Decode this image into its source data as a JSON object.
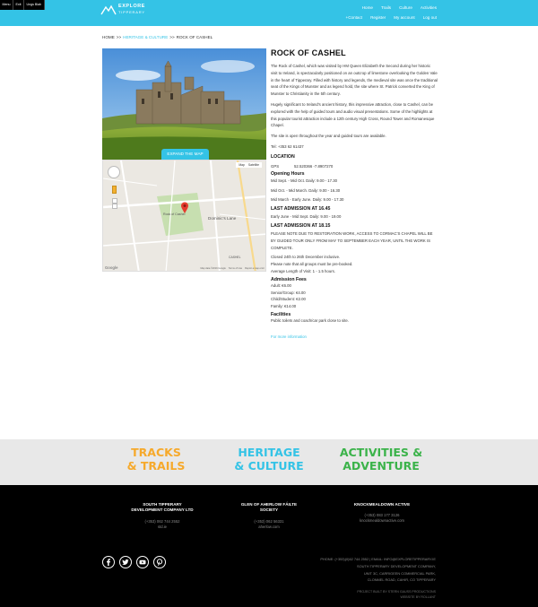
{
  "mini_menu": [
    "Menu",
    "Exit",
    "Ungs Blah"
  ],
  "brand": {
    "line1": "EXPLORE",
    "line2": "TIPPERARY"
  },
  "nav": {
    "primary": [
      "Home",
      "Trails",
      "Culture",
      "Activities"
    ],
    "secondary": [
      "+Contact",
      "Register",
      "My account",
      "Log out"
    ]
  },
  "breadcrumb": {
    "home": "HOME",
    "sep": ">>",
    "section": "HERITAGE & CULTURE",
    "current": "ROCK OF CASHEL"
  },
  "expand_map": "EXPAND THE MAP",
  "map": {
    "tabs": [
      "Map",
      "Satellite"
    ],
    "labels": [
      "Rock of Cashel",
      "Dominic's Lane",
      "CASHEL"
    ],
    "google": "Google",
    "footer": [
      "Map data ©2016 Google",
      "Terms of Use",
      "Report a map error"
    ]
  },
  "page": {
    "title": "ROCK OF CASHEL",
    "intro": "The Rock of Cashel, which was visited by HM Queen Elizabeth the Second during her historic visit to Ireland, is spectacularly positioned on an outcrop of limestone overlooking the Golden Vale in the heart of Tipperary. Filled with history and legends, the medieval site was once the traditional seat of the Kings of Munster and as legend hold, the site where St. Patrick converted the King of Munster to Christianity in the 5th century.",
    "intro2": "Hugely significant to Ireland's ancient history, this impressive attraction, close to Cashel, can be explored with the help of guided tours and audio visual presentations. Some of the highlights at this popular tourist attraction include a 12th century High Cross, Round Tower and Romanesque Chapel.",
    "open_note": "The site is open throughout the year and guided tours are available.",
    "tel": "Tel: +353 62 61437",
    "location_heading": "LOCATION",
    "gps_label": "GPS",
    "gps_value": "52.520366   -7.8907270",
    "hours_heading": "Opening Hours",
    "hours": [
      "Mid Sept. - Mid Oct. Daily: 9.00 - 17.30",
      "Mid Oct. - Mid March. Daily: 9.00 - 16.30",
      "Mid March - Early June. Daily: 9.00 - 17.30"
    ],
    "last_admission_1": "LAST ADMISSION AT 16.45",
    "summer_hours": "Early June - Mid Sept. Daily: 9.00 - 19.00",
    "last_admission_2": "LAST ADMISSION AT 18.15",
    "notice": "PLEASE NOTE DUE TO RESTORATION WORK, ACCESS TO CORMAC'S CHAPEL WILL BE BY GUIDED TOUR ONLY FROM MAY TO SEPTEMBER EACH YEAR, UNTIL THE WORK IS COMPLETE.",
    "closed": "Closed 24th to 26th December inclusive.",
    "groups": "Please note that all groups must be pre-booked.",
    "visit_length": "Average Length of Visit: 1 - 1.5 hours.",
    "fees_heading": "Admission Fees",
    "fees": [
      "Adult: €6.00",
      "Senior/Group: €4.00",
      "Child/Student: €2.00",
      "Family: €14.00"
    ],
    "facilities_heading": "Facilities",
    "facilities": "Public toilets and coach/car park close to site.",
    "more_link": "For more information"
  },
  "categories": [
    {
      "line1": "TRACKS",
      "line2": "& TRAILS",
      "color": "#f6a92b"
    },
    {
      "line1": "HERITAGE",
      "line2": "& CULTURE",
      "color": "#34c3e6"
    },
    {
      "line1": "ACTIVITIES &",
      "line2": "ADVENTURE",
      "color": "#3bb34a"
    }
  ],
  "orgs": [
    {
      "name1": "SOUTH TIPPERARY",
      "name2": "DEVELOPMENT COMPANY LTD",
      "phone": "(+353) 062 744 2552",
      "web": "std.ie"
    },
    {
      "name1": "GLEN OF AHERLOW FÁILTE",
      "name2": "SOCIETY",
      "phone": "(+353) 062 56331",
      "web": "aherlow.com"
    },
    {
      "name1": "KNOCKMEALDOWN ACTIVE",
      "name2": "",
      "phone": "(+353) 083 177 3126",
      "web": "knockmealdownactive.com"
    }
  ],
  "social_icons": [
    "facebook-icon",
    "twitter-icon",
    "youtube-icon",
    "pinterest-icon"
  ],
  "footer_info": [
    "PHONE: (+353)(0)62 744 2552 | EMAIL: INFO@EXPLORETIPPERARY.IE",
    "SOUTH TIPPERARY DEVELOPMENT COMPANY,",
    "UNIT 3C, CARRIGEEN COMMERCIAL PARK,",
    "CLONMEL ROAD, CAHIR, CO TIPPERARY"
  ],
  "credits": [
    "PROJECT BUILT BY STERN GAUSS PRODUCTIONS",
    "WEBSITE BY ROLLANT"
  ],
  "colors": {
    "accent": "#34c3e6",
    "orange": "#f6a92b",
    "green": "#3bb34a"
  }
}
